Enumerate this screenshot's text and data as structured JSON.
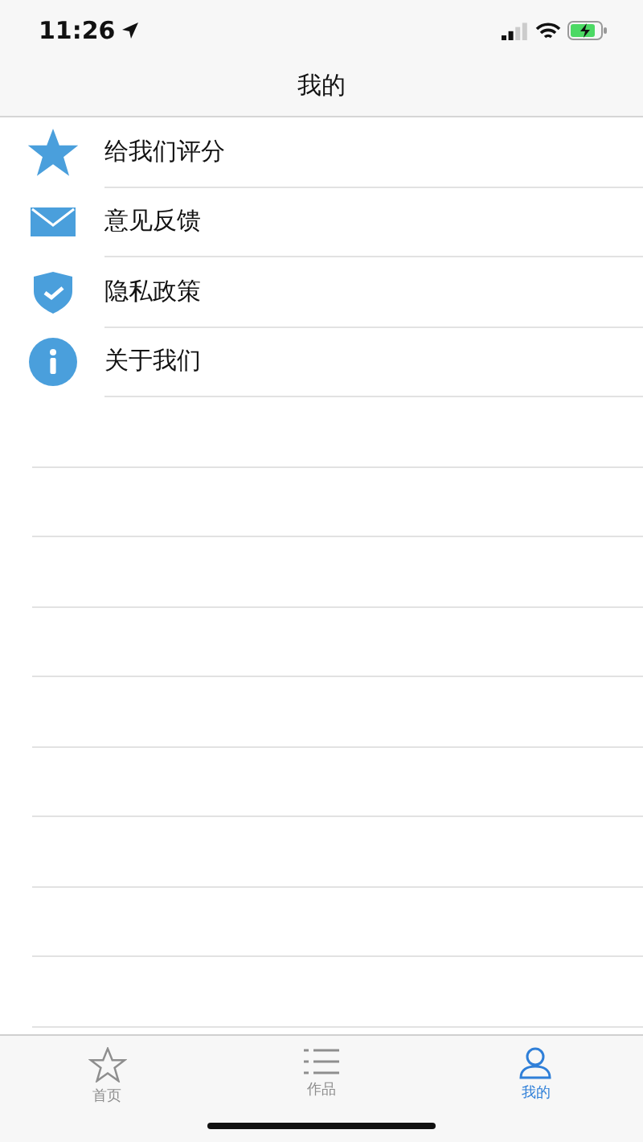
{
  "status_bar": {
    "time": "11:26"
  },
  "nav": {
    "title": "我的"
  },
  "menu": [
    {
      "label": "给我们评分",
      "kind": "star"
    },
    {
      "label": "意见反馈",
      "kind": "mail"
    },
    {
      "label": "隐私政策",
      "kind": "shield"
    },
    {
      "label": "关于我们",
      "kind": "info"
    }
  ],
  "tab_bar": [
    {
      "label": "首页",
      "kind": "star",
      "selected": false
    },
    {
      "label": "作品",
      "kind": "list",
      "selected": false
    },
    {
      "label": "我的",
      "kind": "person",
      "selected": true
    }
  ]
}
